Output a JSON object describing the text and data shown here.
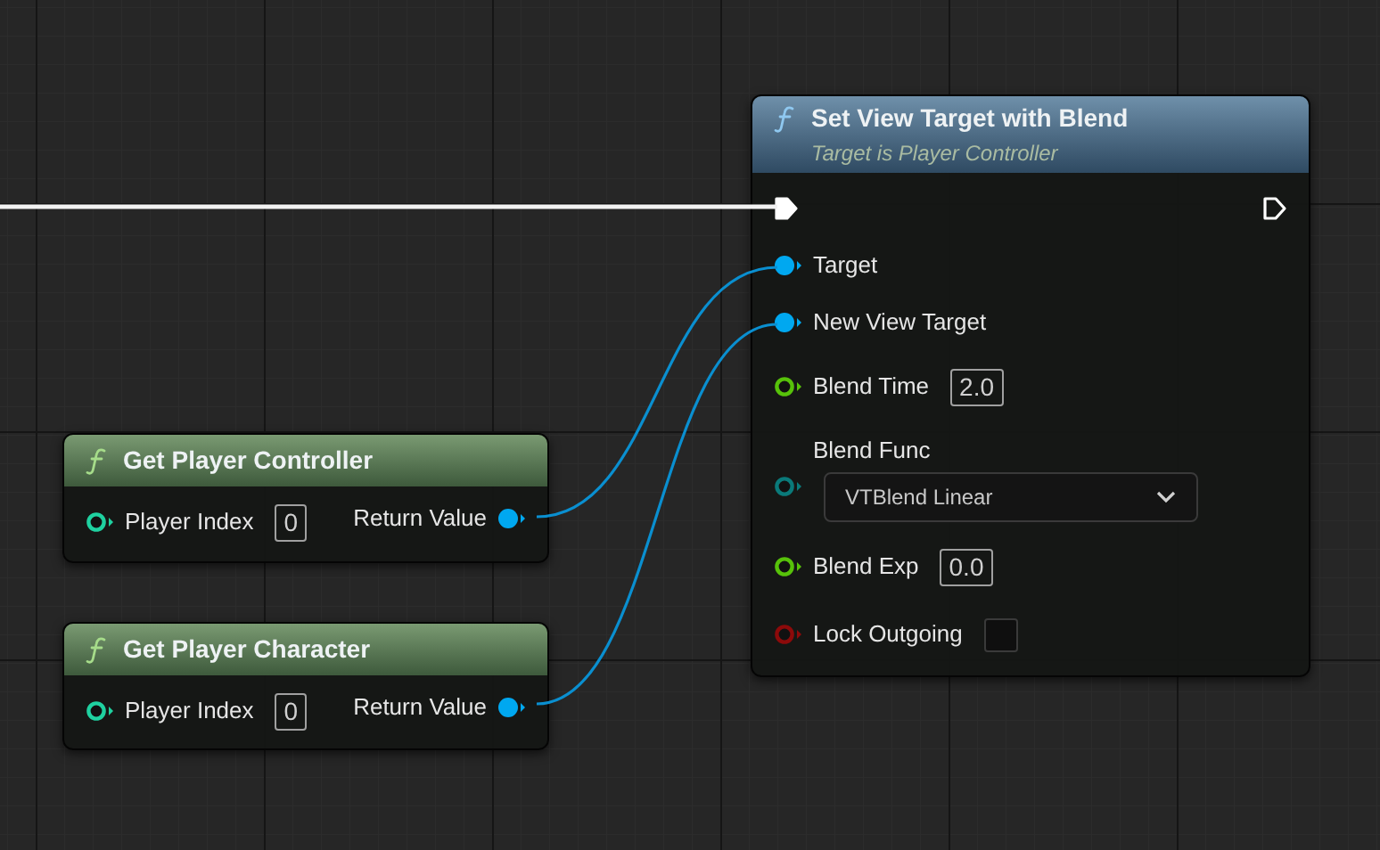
{
  "nodes": [
    {
      "title": "Set View Target with Blend",
      "subtitle": "Target is Player Controller",
      "pure": false,
      "inputs": [
        {
          "kind": "exec",
          "connected": true
        },
        {
          "kind": "object",
          "label": "Target",
          "connected": true
        },
        {
          "kind": "object",
          "label": "New View Target",
          "connected": true
        },
        {
          "kind": "float",
          "label": "Blend Time",
          "connected": false,
          "value": "2.0"
        },
        {
          "kind": "enum",
          "label": "Blend Func",
          "connected": false,
          "value": "VTBlend Linear"
        },
        {
          "kind": "float",
          "label": "Blend Exp",
          "connected": false,
          "value": "0.0"
        },
        {
          "kind": "bool",
          "label": "Lock Outgoing",
          "connected": false,
          "checked": false
        }
      ],
      "outputs": [
        {
          "kind": "exec",
          "connected": false
        }
      ]
    },
    {
      "title": "Get Player Controller",
      "pure": true,
      "inputs": [
        {
          "kind": "int",
          "label": "Player Index",
          "connected": false,
          "value": "0"
        }
      ],
      "outputs": [
        {
          "kind": "object",
          "label": "Return Value",
          "connected": true
        }
      ]
    },
    {
      "title": "Get Player Character",
      "pure": true,
      "inputs": [
        {
          "kind": "int",
          "label": "Player Index",
          "connected": false,
          "value": "0"
        }
      ],
      "outputs": [
        {
          "kind": "object",
          "label": "Return Value",
          "connected": true
        }
      ]
    }
  ]
}
